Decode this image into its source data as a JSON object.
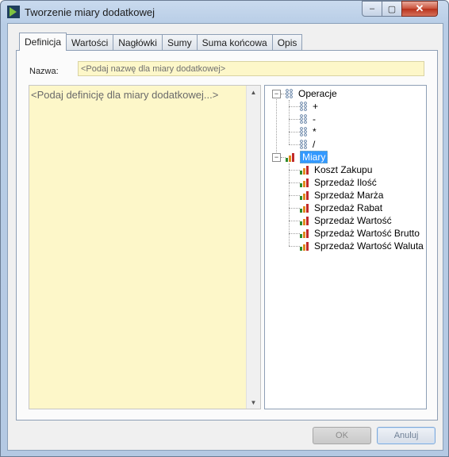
{
  "window": {
    "title": "Tworzenie miary dodatkowej",
    "controls": {
      "minimize": "‒",
      "maximize": "▢",
      "close": "✕"
    }
  },
  "tabs": [
    {
      "label": "Definicja",
      "active": true
    },
    {
      "label": "Wartości",
      "active": false
    },
    {
      "label": "Nagłówki",
      "active": false
    },
    {
      "label": "Sumy",
      "active": false
    },
    {
      "label": "Suma końcowa",
      "active": false
    },
    {
      "label": "Opis",
      "active": false
    }
  ],
  "form": {
    "name_label": "Nazwa:",
    "name_placeholder": "<Podaj nazwę dla miary dodatkowej>",
    "definition_placeholder": "<Podaj definicję dla miary dodatkowej...>"
  },
  "tree": {
    "operations": {
      "label": "Operacje",
      "expander": "−",
      "items": [
        "+",
        "-",
        "*",
        "/"
      ]
    },
    "measures": {
      "label": "Miary",
      "expander": "−",
      "items": [
        "Koszt Zakupu",
        "Sprzedaż Ilość",
        "Sprzedaż Marża",
        "Sprzedaż Rabat",
        "Sprzedaż Wartość",
        "Sprzedaż Wartość Brutto",
        "Sprzedaż Wartość Waluta"
      ]
    }
  },
  "buttons": {
    "ok": "OK",
    "cancel": "Anuluj"
  },
  "colors": {
    "input_bg": "#fdf7c9",
    "selection": "#3399ff",
    "close_button": "#c9523a"
  }
}
